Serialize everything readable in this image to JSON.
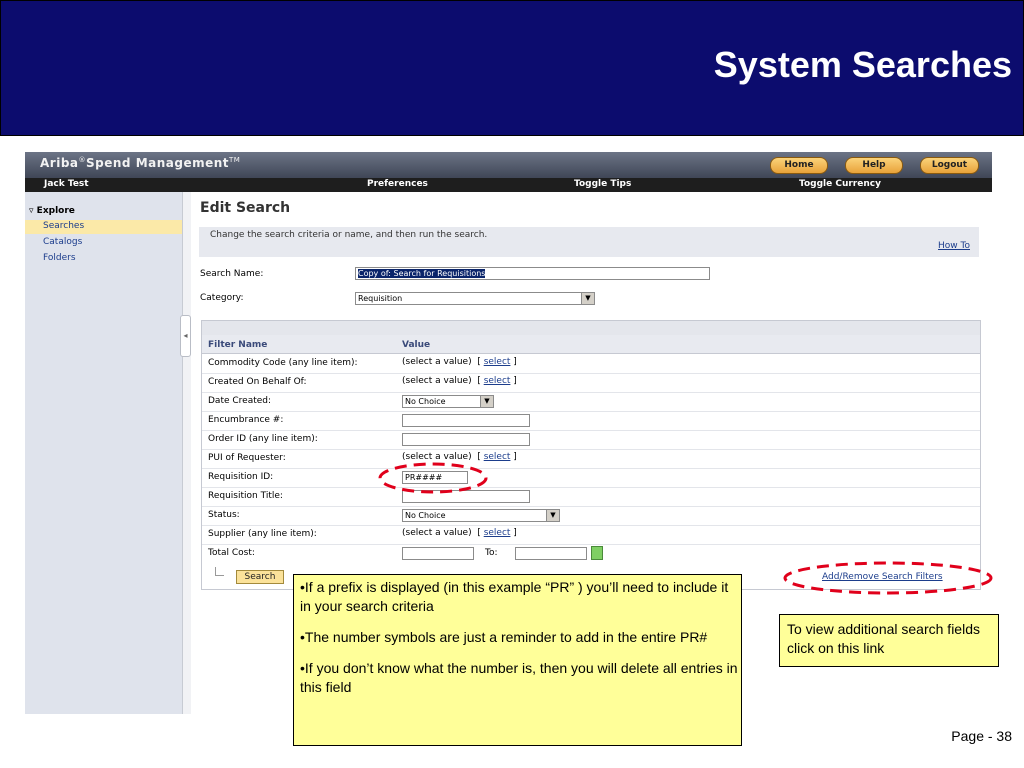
{
  "slide": {
    "title": "System Searches",
    "page": "Page - 38"
  },
  "app": {
    "brand": "Ariba",
    "brand_mark": "®",
    "brand_rest": "Spend Management",
    "brand_tm": "TM",
    "top_buttons": {
      "home": "Home",
      "help": "Help",
      "logout": "Logout"
    },
    "nav": {
      "user": "Jack Test",
      "preferences": "Preferences",
      "toggle_tips": "Toggle Tips",
      "toggle_currency": "Toggle Currency"
    },
    "sidebar": {
      "section": "Explore",
      "items": [
        "Searches",
        "Catalogs",
        "Folders"
      ]
    },
    "page_title": "Edit Search",
    "instructions": "Change the search criteria or name, and then run the search.",
    "how_to": "How To",
    "search_name_label": "Search Name:",
    "search_name_value": "Copy of: Search for Requisitions",
    "category_label": "Category:",
    "category_value": "Requisition",
    "filters": {
      "col_name": "Filter Name",
      "col_value": "Value",
      "rows": [
        {
          "name": "Commodity Code (any line item):",
          "value": "(select a value)",
          "link": "select"
        },
        {
          "name": "Created On Behalf Of:",
          "value": "(select a value)",
          "link": "select"
        },
        {
          "name": "Date Created:",
          "dropdown": "No Choice"
        },
        {
          "name": "Encumbrance #:",
          "input": ""
        },
        {
          "name": "Order ID (any line item):",
          "input": ""
        },
        {
          "name": "PUI of Requester:",
          "value": "(select a value)",
          "link": "select"
        },
        {
          "name": "Requisition ID:",
          "input": "PR####"
        },
        {
          "name": "Requisition Title:",
          "input": ""
        },
        {
          "name": "Status:",
          "dropdown": "No Choice"
        },
        {
          "name": "Supplier (any line item):",
          "value": "(select a value)",
          "link": "select"
        },
        {
          "name": "Total Cost:",
          "to_label": "To:"
        }
      ]
    },
    "search_button": "Search",
    "add_remove_link": "Add/Remove Search Filters"
  },
  "callouts": {
    "main": [
      "•If a prefix is displayed (in this example “PR” ) you’ll need to include it in your search criteria",
      "•The number symbols are just a reminder to add in the entire PR#",
      "•If you don’t know what the number is, then you will delete all entries in this field"
    ],
    "side": "To view additional search fields click on this link"
  },
  "colors": {
    "header_bg": "#0c0c6e",
    "callout_bg": "#ffff99",
    "highlight_ring": "#e0001b",
    "link": "#1c3d8c"
  }
}
